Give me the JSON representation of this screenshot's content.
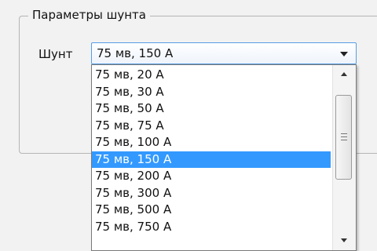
{
  "group": {
    "title": "Параметры шунта"
  },
  "shunt": {
    "label": "Шунт",
    "selected_value": "75 мв, 150 А",
    "options": [
      "75 мв, 20 А",
      "75 мв, 30 А",
      "75 мв, 50 А",
      "75 мв, 75 А",
      "75 мв, 100 А",
      "75 мв, 150 А",
      "75 мв, 200 А",
      "75 мв, 300 А",
      "75 мв, 500 А",
      "75 мв, 750 А"
    ],
    "selected_index": 5
  },
  "icons": {
    "combo_arrow": "chevron-down-icon",
    "scroll_up": "scroll-up-arrow-icon",
    "scroll_down": "scroll-down-arrow-icon"
  },
  "colors": {
    "selection": "#3399ff",
    "combo_border": "#569de5"
  }
}
